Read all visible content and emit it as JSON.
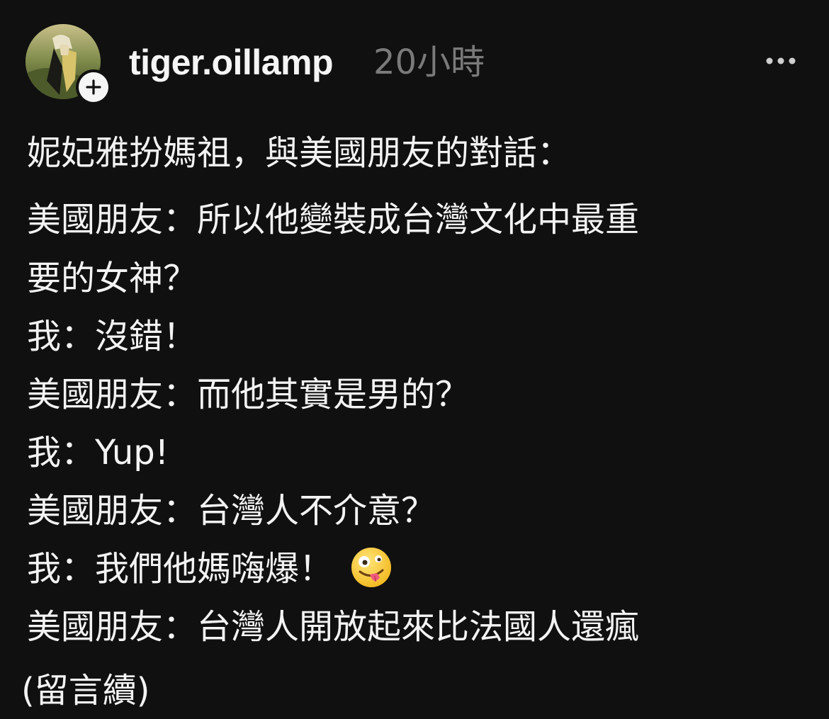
{
  "post": {
    "author": {
      "username": "tiger.oillamp",
      "avatar_icon": "profile-avatar",
      "follow_icon": "plus-icon"
    },
    "timestamp": "20小時",
    "more_icon": "more-horizontal-icon",
    "title_line": "妮妃雅扮媽祖，與美國朋友的對話：",
    "dialogue": [
      "美國朋友：所以他變裝成台灣文化中最重",
      "要的女神？",
      "我：沒錯！",
      "美國朋友：而他其實是男的？",
      "我：Yup!",
      "美國朋友：台灣人不介意？",
      "我：我們他媽嗨爆！",
      "美國朋友：台灣人開放起來比法國人還瘋"
    ],
    "emoji": "zany-face",
    "continued_text": "(留言續)"
  },
  "colors": {
    "background": "#101010",
    "text": "#f3f3f3",
    "muted": "#7a7a7a"
  }
}
